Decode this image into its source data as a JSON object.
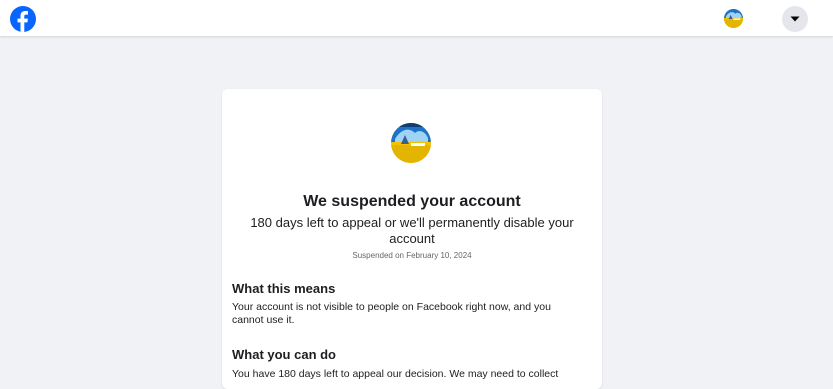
{
  "topbar": {
    "logo_icon": "facebook-logo-icon",
    "avatar_icon": "profile-avatar",
    "menu_icon": "caret-down-icon",
    "brand_color": "#0866ff"
  },
  "card": {
    "avatar_icon": "profile-avatar",
    "title": "We suspended your account",
    "subtitle": "180 days left to appeal or we'll permanently disable your account",
    "date": "Suspended on February 10, 2024",
    "sections": [
      {
        "heading": "What this means",
        "body": "Your account is not visible to people on Facebook right now, and you cannot use it."
      },
      {
        "heading": "What you can do",
        "body": "You have 180 days left to appeal our decision. We may need to collect"
      }
    ]
  }
}
